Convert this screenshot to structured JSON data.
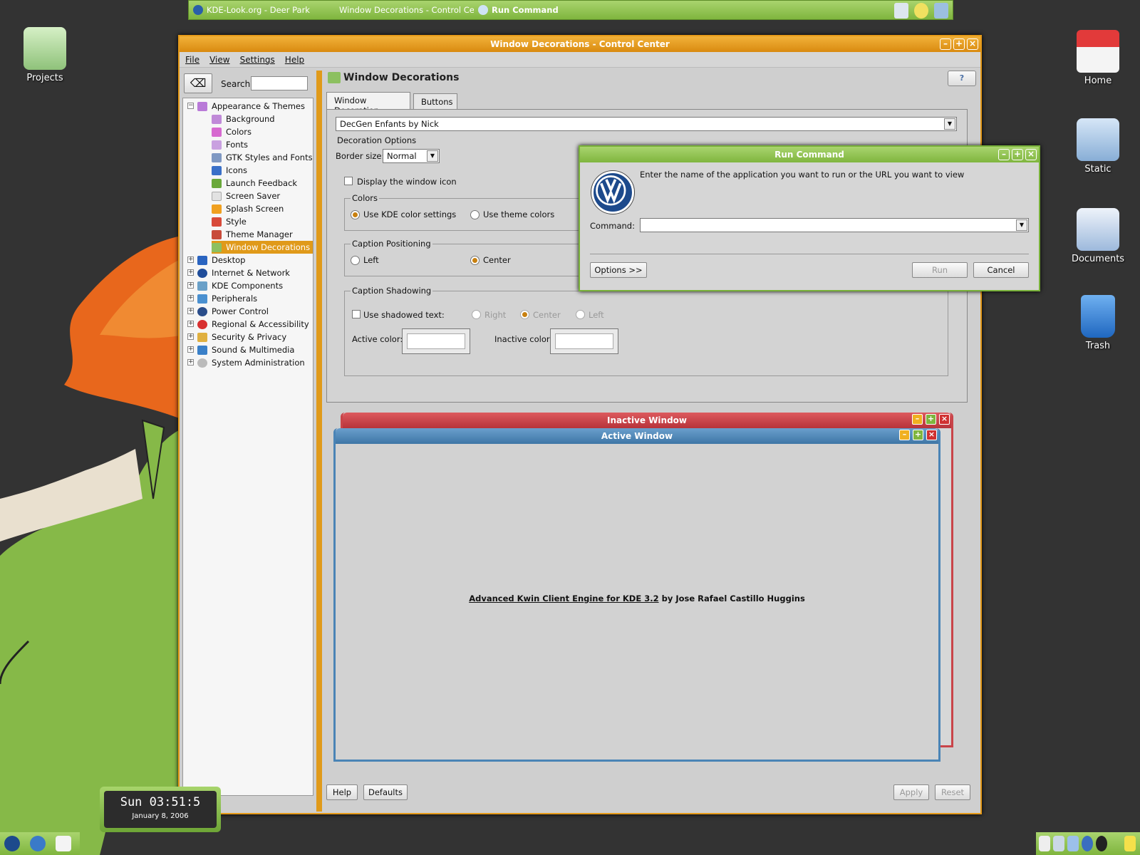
{
  "taskbar": {
    "tasks": [
      "KDE-Look.org - Deer Park",
      "Window Decorations - Control Cente",
      "Run Command"
    ]
  },
  "desktop_icons": {
    "projects": "Projects",
    "home": "Home",
    "static": "Static",
    "documents": "Documents",
    "trash": "Trash"
  },
  "control_center": {
    "title": "Window Decorations - Control Center",
    "menu": [
      "File",
      "View",
      "Settings",
      "Help"
    ],
    "search_label": "Search:",
    "tree": {
      "appearance": "Appearance & Themes",
      "children": [
        "Background",
        "Colors",
        "Fonts",
        "GTK Styles and Fonts",
        "Icons",
        "Launch Feedback",
        "Screen Saver",
        "Splash Screen",
        "Style",
        "Theme Manager",
        "Window Decorations"
      ],
      "roots": [
        "Desktop",
        "Internet & Network",
        "KDE Components",
        "Peripherals",
        "Power Control",
        "Regional & Accessibility",
        "Security & Privacy",
        "Sound & Multimedia",
        "System Administration"
      ]
    },
    "content": {
      "title": "Window Decorations",
      "help": "?",
      "tabs": [
        "Window Decoration",
        "Buttons"
      ],
      "decoration": "DecGen Enfants by Nick",
      "decoration_options": "Decoration Options",
      "border_size_label": "Border size:",
      "border_size": "Normal",
      "display_icon": "Display the window icon",
      "colors_group": "Colors",
      "use_kde_colors": "Use KDE color settings",
      "use_theme_colors": "Use theme colors",
      "caption_pos_group": "Caption Positioning",
      "pos_left": "Left",
      "pos_center": "Center",
      "caption_shadow_group": "Caption Shadowing",
      "use_shadowed": "Use shadowed text:",
      "sh_right": "Right",
      "sh_center": "Center",
      "sh_left": "Left",
      "active_color": "Active color:",
      "inactive_color": "Inactive color:"
    },
    "preview": {
      "inactive": "Inactive Window",
      "active": "Active Window",
      "credit_link": "Advanced Kwin Client Engine for KDE 3.2",
      "credit_rest": " by Jose Rafael Castillo Huggins"
    },
    "buttons": {
      "help": "Help",
      "defaults": "Defaults",
      "apply": "Apply",
      "reset": "Reset"
    }
  },
  "run_command": {
    "title": "Run Command",
    "prompt": "Enter the name of the application you want to run or the URL you want to view",
    "command_label": "Command:",
    "command_value": "",
    "options": "Options >>",
    "run": "Run",
    "cancel": "Cancel"
  },
  "clock": {
    "time": "Sun 03:51:5",
    "date": "January 8, 2006"
  },
  "colors": {
    "accent": "#e09a1a",
    "green": "#7fb53e",
    "inactive_title": "#c94449",
    "active_title": "#4a84b6"
  }
}
